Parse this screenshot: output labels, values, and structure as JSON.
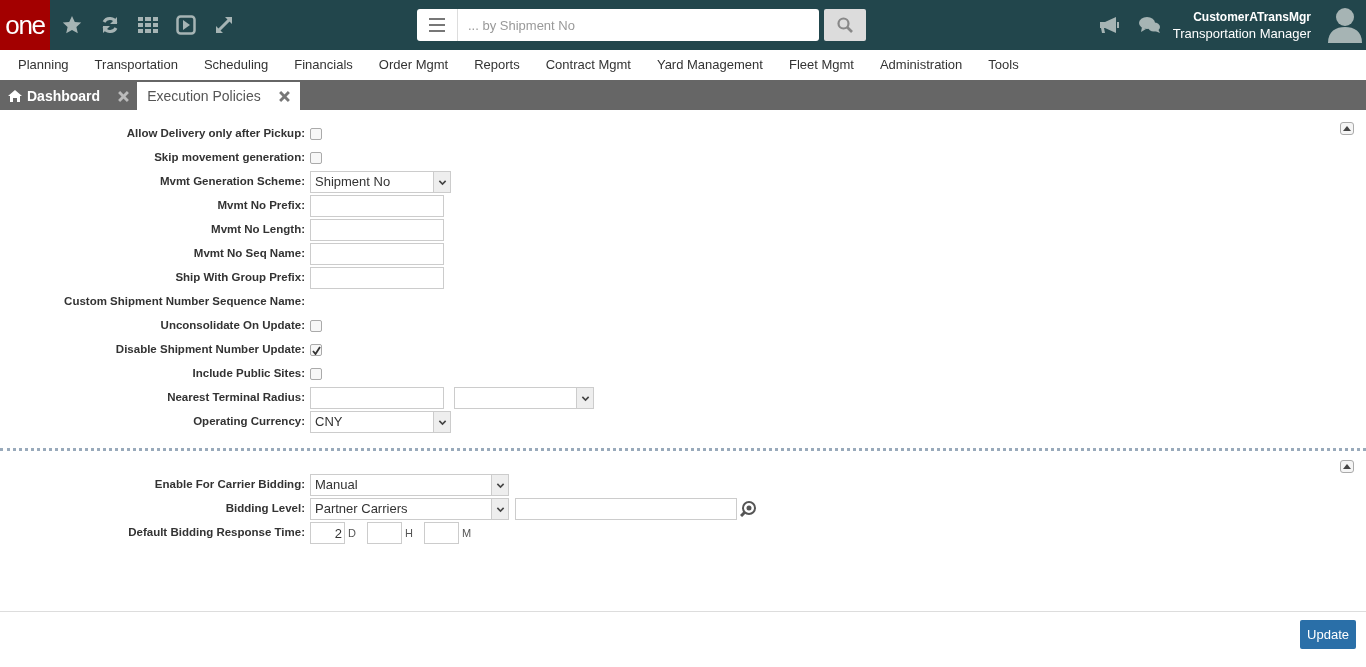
{
  "header": {
    "logo": "one",
    "search": {
      "placeholder": "... by Shipment No"
    },
    "user": {
      "name": "CustomerATransMgr",
      "role": "Transportation Manager"
    }
  },
  "nav": [
    "Planning",
    "Transportation",
    "Scheduling",
    "Financials",
    "Order Mgmt",
    "Reports",
    "Contract Mgmt",
    "Yard Management",
    "Fleet Mgmt",
    "Administration",
    "Tools"
  ],
  "tabs": [
    {
      "label": "Dashboard",
      "selected": false,
      "home": true
    },
    {
      "label": "Execution Policies",
      "selected": true,
      "home": false
    }
  ],
  "sections": [
    {
      "rows": [
        {
          "label": "Allow Delivery only after Pickup:",
          "kind": "checkbox",
          "checked": false
        },
        {
          "label": "Skip movement generation:",
          "kind": "checkbox",
          "checked": false
        },
        {
          "label": "Mvmt Generation Scheme:",
          "kind": "select",
          "value": "Shipment No"
        },
        {
          "label": "Mvmt No Prefix:",
          "kind": "text"
        },
        {
          "label": "Mvmt No Length:",
          "kind": "text"
        },
        {
          "label": "Mvmt No Seq Name:",
          "kind": "text"
        },
        {
          "label": "Ship With Group Prefix:",
          "kind": "text"
        },
        {
          "label": "Custom Shipment Number Sequence Name:",
          "kind": "label"
        },
        {
          "label": "Unconsolidate On Update:",
          "kind": "checkbox",
          "checked": false
        },
        {
          "label": "Disable Shipment Number Update:",
          "kind": "checkbox",
          "checked": true
        },
        {
          "label": "Include Public Sites:",
          "kind": "checkbox",
          "checked": false
        },
        {
          "label": "Nearest Terminal Radius:",
          "kind": "text_select"
        },
        {
          "label": "Operating Currency:",
          "kind": "select",
          "value": "CNY"
        }
      ]
    },
    {
      "rows": [
        {
          "label": "Enable For Carrier Bidding:",
          "kind": "wide_select",
          "value": "Manual"
        },
        {
          "label": "Bidding Level:",
          "kind": "select_lookup",
          "value": "Partner Carriers"
        },
        {
          "label": "Default Bidding Response Time:",
          "kind": "duration",
          "parts": [
            {
              "value": "2",
              "unit": "D"
            },
            {
              "unit": "H"
            },
            {
              "unit": "M"
            }
          ]
        }
      ]
    }
  ],
  "footer": {
    "button": "Update"
  }
}
